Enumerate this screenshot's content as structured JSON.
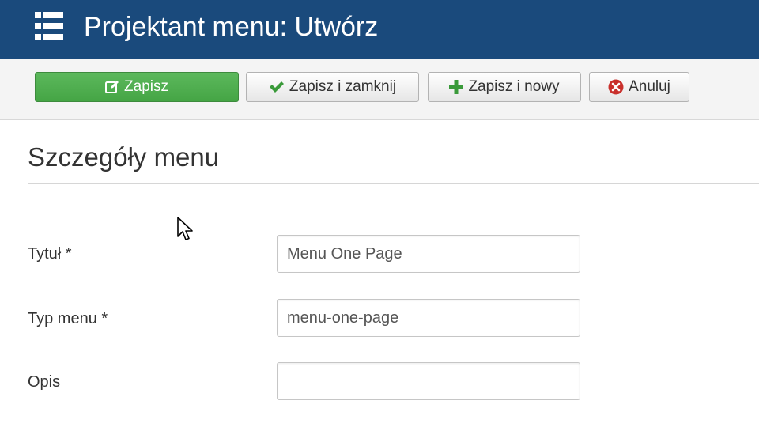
{
  "header": {
    "title": "Projektant menu: Utwórz",
    "icon": "list-menu-icon"
  },
  "toolbar": {
    "save": {
      "label": "Zapisz",
      "icon": "edit-icon",
      "color": "#5cb85c"
    },
    "save_close": {
      "label": "Zapisz i zamknij",
      "icon": "check-icon",
      "icon_color": "#3a9a3a"
    },
    "save_new": {
      "label": "Zapisz i nowy",
      "icon": "plus-icon",
      "icon_color": "#3a9a3a"
    },
    "cancel": {
      "label": "Anuluj",
      "icon": "cancel-circle-icon",
      "icon_color": "#c9302c"
    }
  },
  "section": {
    "title": "Szczegóły menu"
  },
  "form": {
    "title": {
      "label": "Tytuł *",
      "value": "Menu One Page"
    },
    "menu_type": {
      "label": "Typ menu *",
      "value": "menu-one-page"
    },
    "description": {
      "label": "Opis",
      "value": ""
    }
  },
  "colors": {
    "header_bg": "#1a4a7c",
    "toolbar_bg": "#f4f4f4"
  }
}
